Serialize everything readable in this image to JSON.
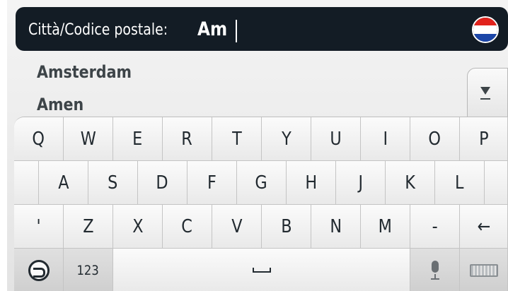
{
  "search": {
    "label": "Città/Codice postale:",
    "value": "Am",
    "flag_icon": "netherlands-flag-icon"
  },
  "results": [
    {
      "name": "Amsterdam"
    },
    {
      "name": "Amen"
    }
  ],
  "scroll_icon": "scroll-down-icon",
  "keyboard": {
    "row1": [
      "Q",
      "W",
      "E",
      "R",
      "T",
      "Y",
      "U",
      "I",
      "O",
      "P"
    ],
    "row2": [
      "A",
      "S",
      "D",
      "F",
      "G",
      "H",
      "J",
      "K",
      "L"
    ],
    "row3": [
      "'",
      "Z",
      "X",
      "C",
      "V",
      "B",
      "N",
      "M",
      "-",
      "←"
    ],
    "numbers_label": "123",
    "icons": [
      "back-icon",
      "space-icon",
      "microphone-icon",
      "keyboard-switch-icon",
      "backspace-icon"
    ]
  },
  "colors": {
    "header_bg": "#131c25",
    "text_dark": "#3d4448",
    "flag_red": "#e1221c",
    "flag_blue": "#1c46a8"
  }
}
